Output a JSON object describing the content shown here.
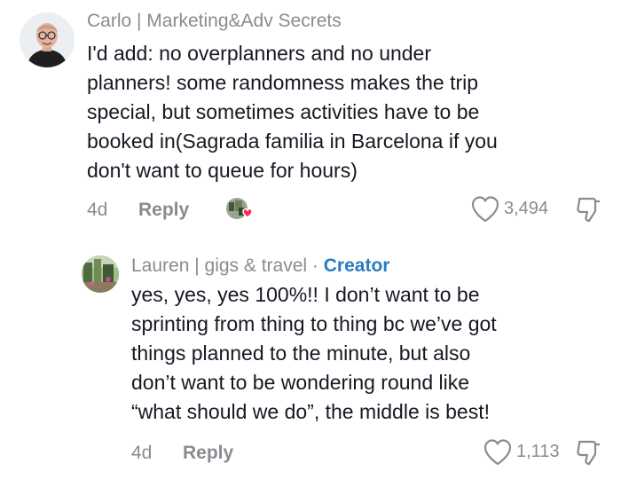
{
  "comments": [
    {
      "author": "Carlo | Marketing&Adv Secrets",
      "avatar_icon": "person-with-glasses-avatar",
      "lines": [
        "I'd add: no overplanners and no under",
        "planners! some randomness makes the trip",
        "special, but sometimes activities have to be",
        "booked in(Sagrada familia in Barcelona if you",
        "don't want to queue for hours)"
      ],
      "age": "4d",
      "reply_label": "Reply",
      "creator_liked": true,
      "likes": "3,494"
    },
    {
      "author": "Lauren | gigs & travel",
      "separator": "·",
      "badge": "Creator",
      "avatar_icon": "garden-photo-avatar",
      "lines": [
        "yes, yes, yes 100%!! I don’t want to be",
        "sprinting from thing to thing bc we’ve got",
        "things planned to the minute, but also",
        "don’t want to be wondering round like",
        "“what should we do”, the middle is best!"
      ],
      "age": "4d",
      "reply_label": "Reply",
      "likes": "1,113"
    }
  ],
  "colors": {
    "text": "#161823",
    "muted": "#8a8b91",
    "creator": "#2b7bbd",
    "heart_badge": "#fe2c55"
  }
}
